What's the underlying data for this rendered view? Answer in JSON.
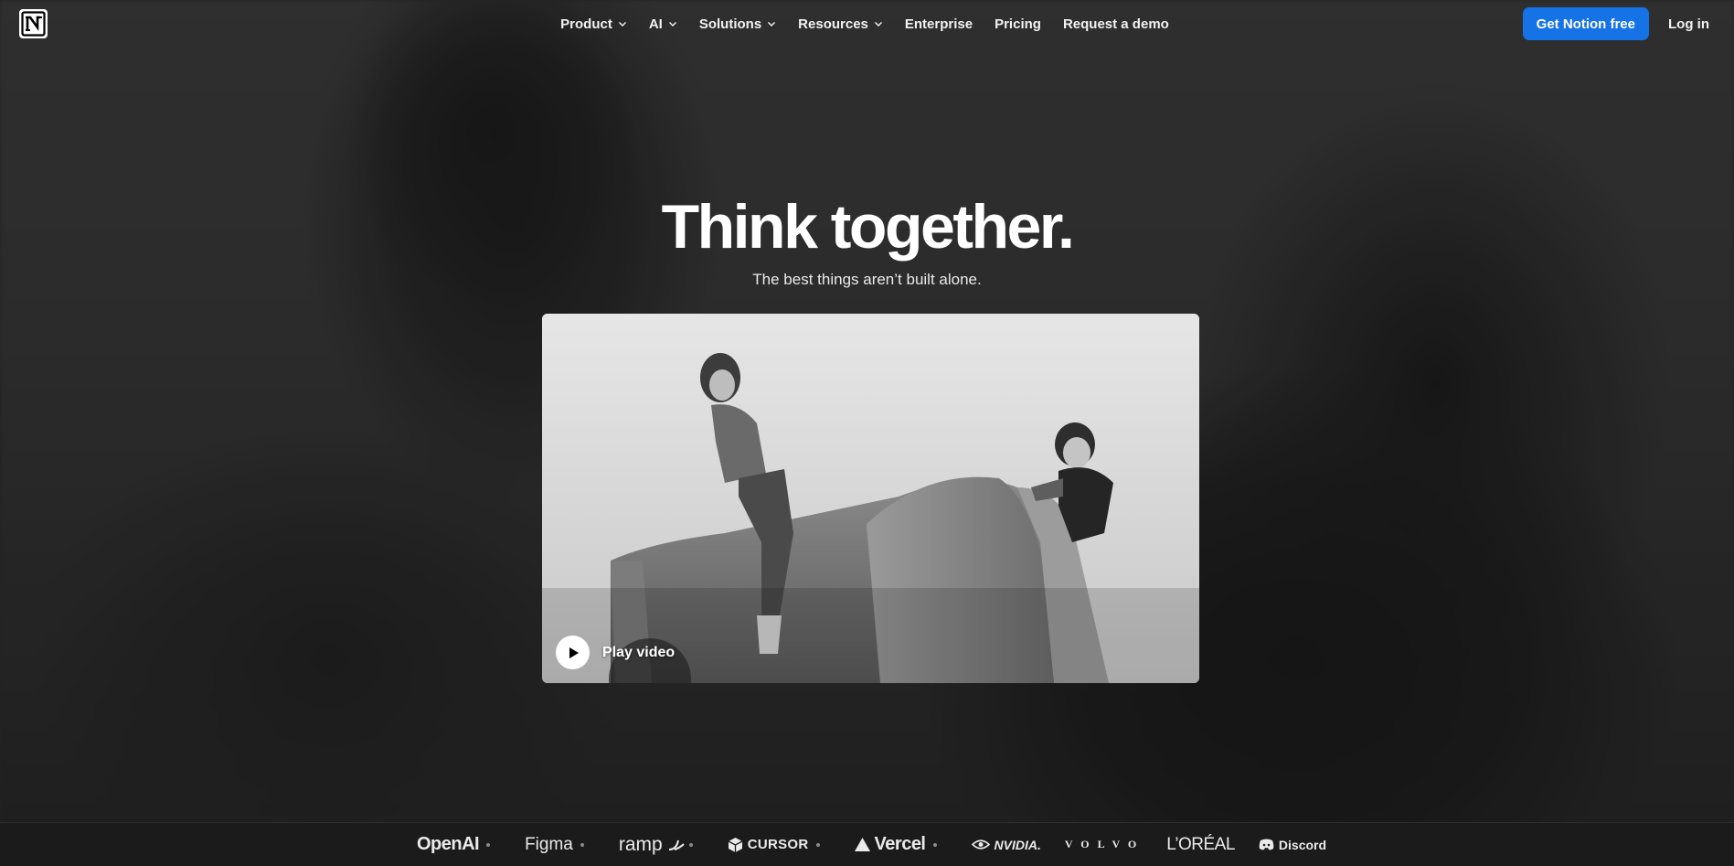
{
  "nav": {
    "logo_icon": "notion-logo-icon",
    "items": [
      {
        "label": "Product",
        "has_dropdown": true
      },
      {
        "label": "AI",
        "has_dropdown": true
      },
      {
        "label": "Solutions",
        "has_dropdown": true
      },
      {
        "label": "Resources",
        "has_dropdown": true
      },
      {
        "label": "Enterprise",
        "has_dropdown": false
      },
      {
        "label": "Pricing",
        "has_dropdown": false
      },
      {
        "label": "Request a demo",
        "has_dropdown": false
      }
    ],
    "cta_label": "Get Notion free",
    "login_label": "Log in"
  },
  "hero": {
    "title": "Think together.",
    "subtitle": "The best things aren’t built alone."
  },
  "video": {
    "play_label": "Play video",
    "play_icon": "play-icon"
  },
  "logos": [
    "OpenAI",
    "Figma",
    "ramp",
    "CURSOR",
    "Vercel",
    "NVIDIA.",
    "VOLVO",
    "L’ORÉAL",
    "Discord"
  ],
  "colors": {
    "cta_bg": "#1673e6",
    "page_bg": "#2b2b2b",
    "logo_bar_bg": "#1b1b1b"
  }
}
